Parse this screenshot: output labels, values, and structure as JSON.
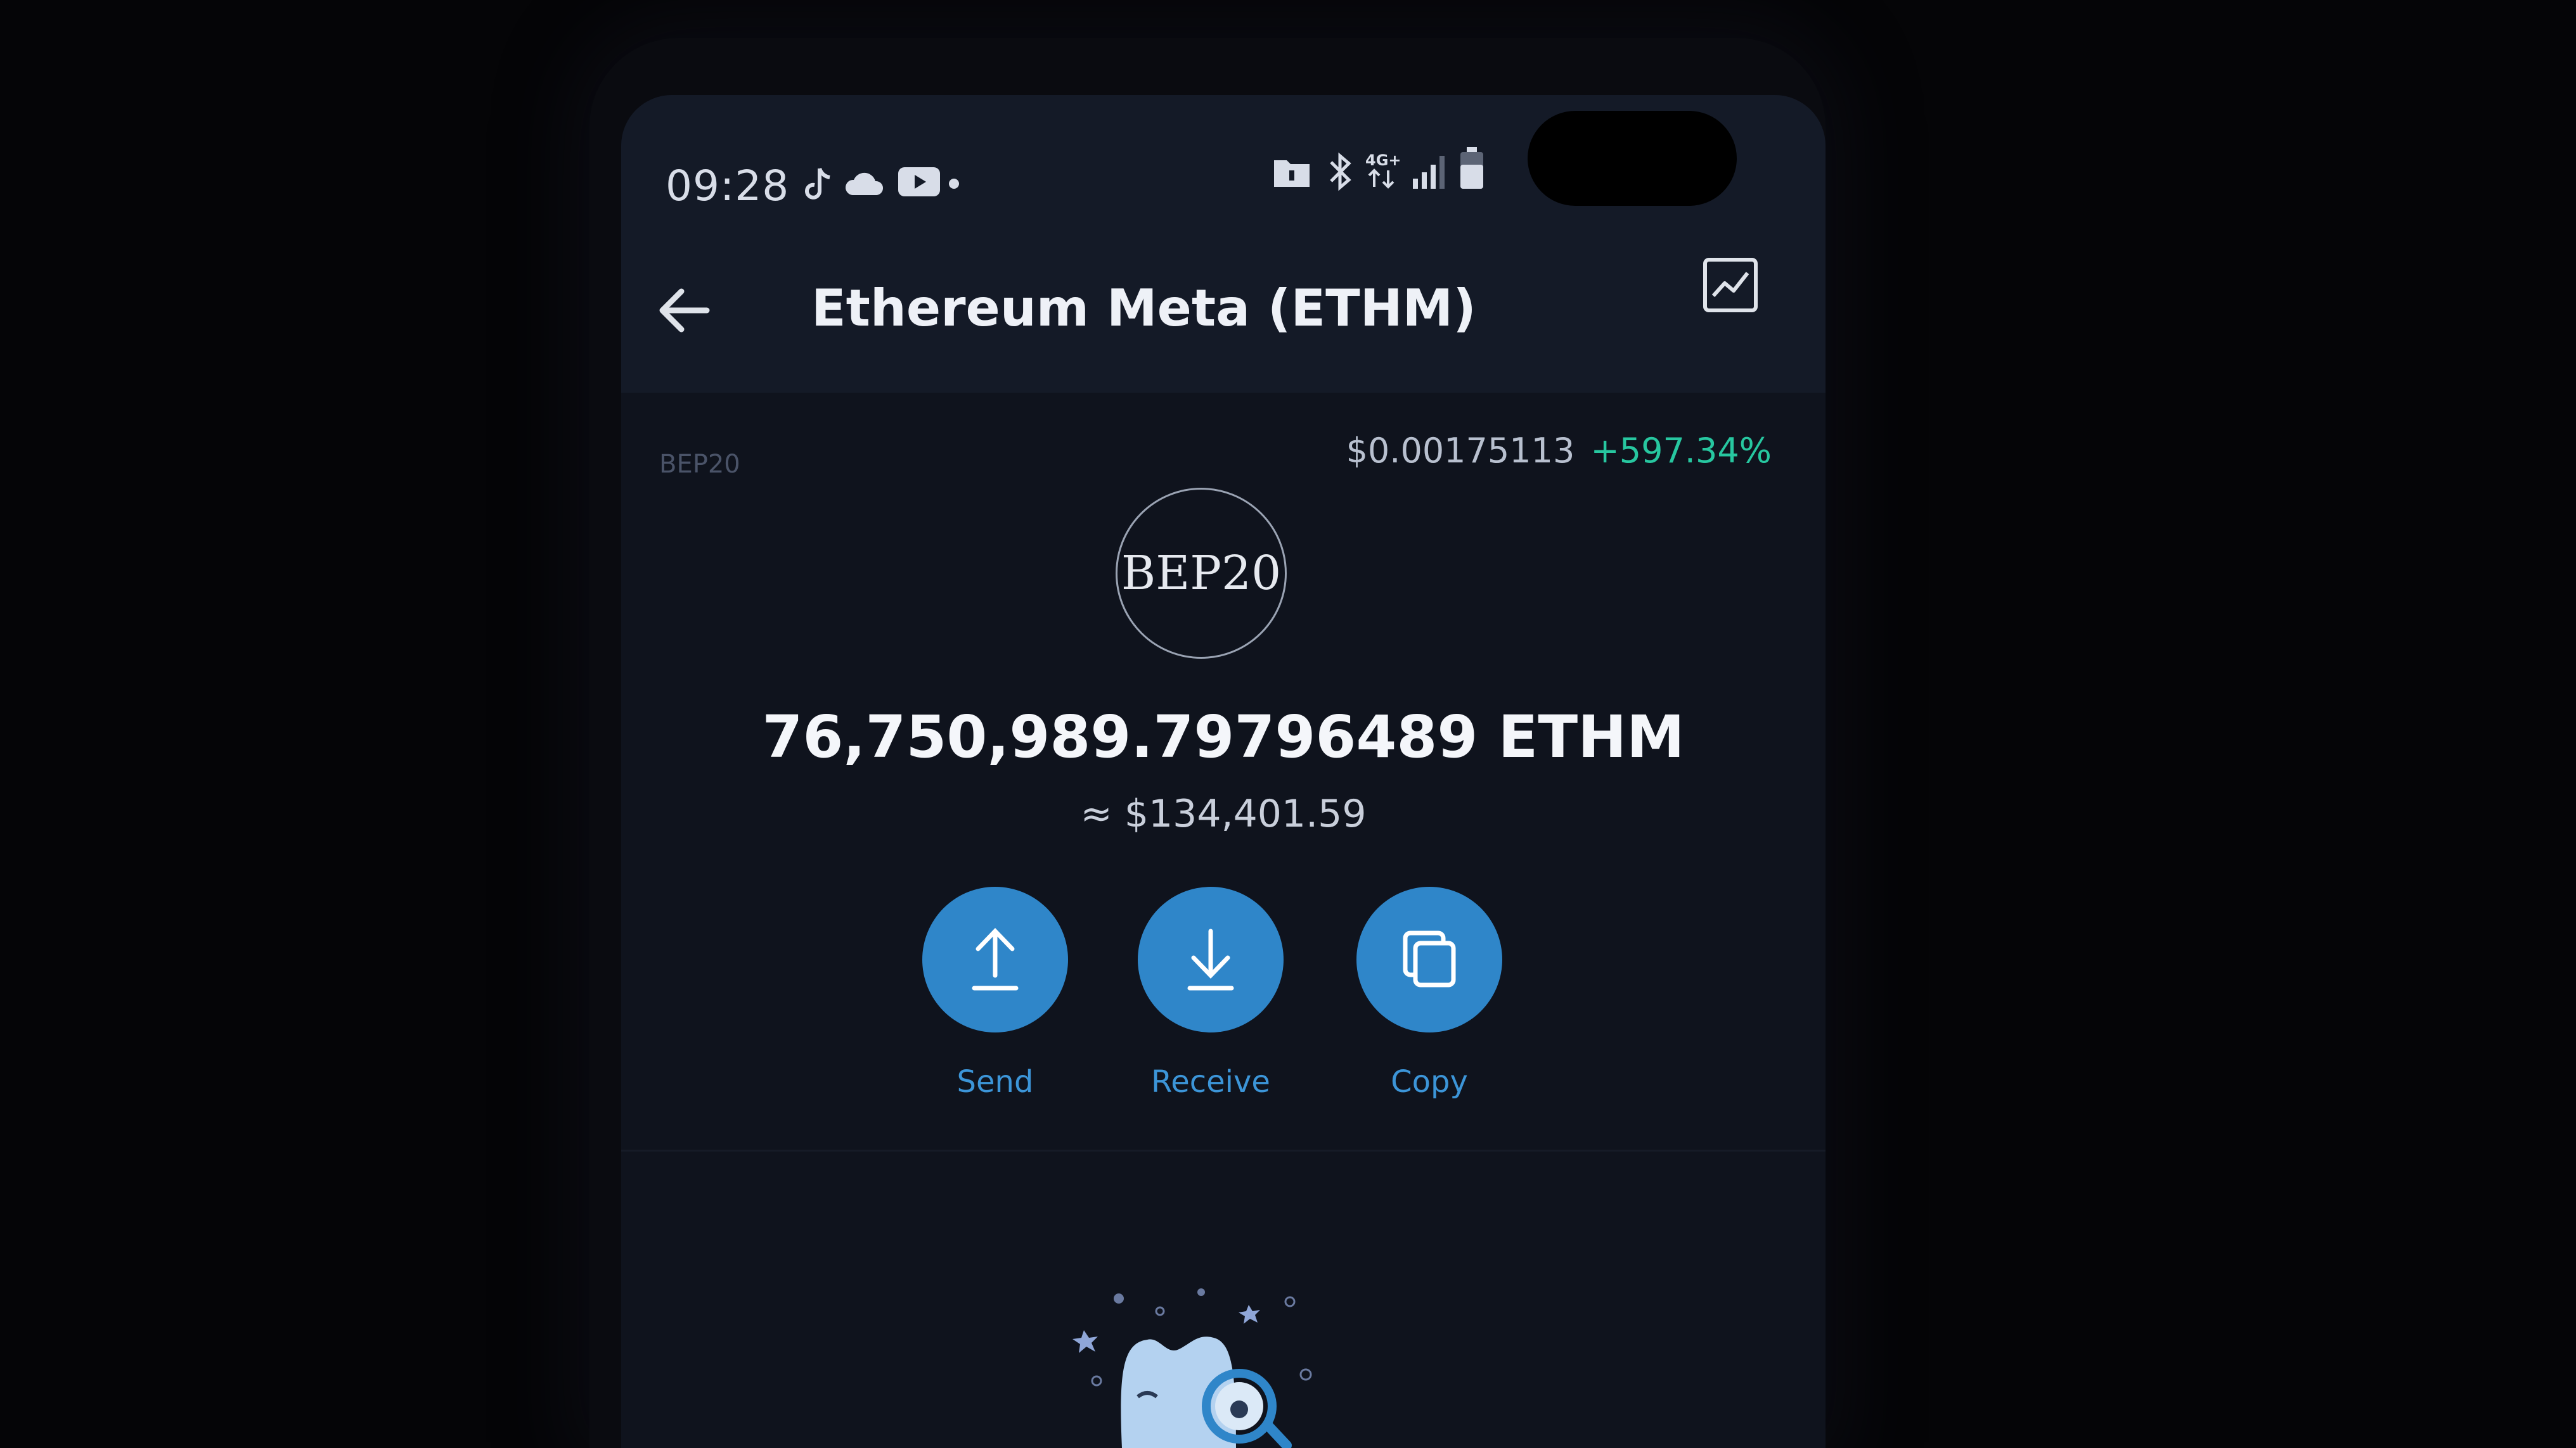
{
  "status_bar": {
    "time": "09:28",
    "icons_left": [
      "tiktok-icon",
      "cloud-icon",
      "youtube-icon",
      "dot-icon"
    ],
    "icons_right": [
      "folder-icon",
      "bluetooth-icon",
      "4g-data-icon",
      "signal-icon",
      "battery-icon"
    ],
    "network_label": "4G+"
  },
  "header": {
    "title": "Ethereum Meta (ETHM)",
    "back_icon": "arrow-left-icon",
    "chart_icon": "chart-line-icon"
  },
  "token": {
    "network": "BEP20",
    "price": "$0.00175113",
    "change": "+597.34%",
    "logo_text": "BEP20",
    "balance": "76,750,989.79796489 ETHM",
    "fiat_value": "≈ $134,401.59"
  },
  "actions": [
    {
      "label": "Send",
      "icon": "arrow-up-icon"
    },
    {
      "label": "Receive",
      "icon": "arrow-down-icon"
    },
    {
      "label": "Copy",
      "icon": "copy-icon"
    }
  ],
  "colors": {
    "accent": "#2f86c9",
    "positive": "#27c7a0",
    "background": "#0f131d",
    "header": "#141a27"
  }
}
